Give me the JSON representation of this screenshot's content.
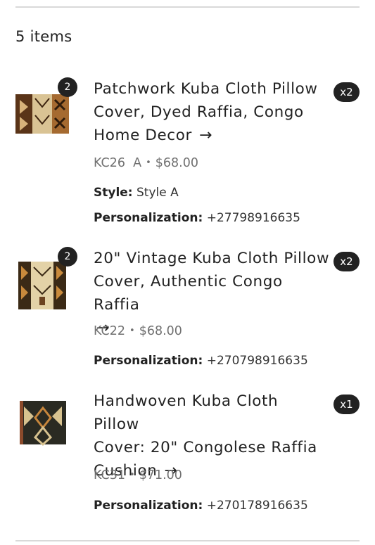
{
  "cart": {
    "items_count_label": "5 items"
  },
  "items": [
    {
      "title_lines": [
        "Patchwork Kuba Cloth Pillow",
        "Cover, Dyed Raffia, Congo",
        "Home Decor"
      ],
      "badge_count": "2",
      "quantity": "x2",
      "sku": "KC26  A",
      "price": "$68.00",
      "style_label": "Style:",
      "style_value": "Style A",
      "personalization_label": "Personalization:",
      "personalization_value": "+27798916635"
    },
    {
      "title_lines": [
        "20\" Vintage Kuba Cloth Pillow",
        "Cover, Authentic Congo Raffia"
      ],
      "badge_count": "2",
      "quantity": "x2",
      "sku": "KC22",
      "price": "$68.00",
      "personalization_label": "Personalization:",
      "personalization_value": "+270798916635"
    },
    {
      "title_lines": [
        "Handwoven Kuba Cloth Pillow",
        "Cover: 20\" Congolese Raffia",
        "Cushion"
      ],
      "quantity": "x1",
      "sku": "KC31",
      "price": "$71.00",
      "personalization_label": "Personalization:",
      "personalization_value": "+270178916635"
    }
  ],
  "icons": {
    "arrow": "→",
    "separator": "•"
  }
}
